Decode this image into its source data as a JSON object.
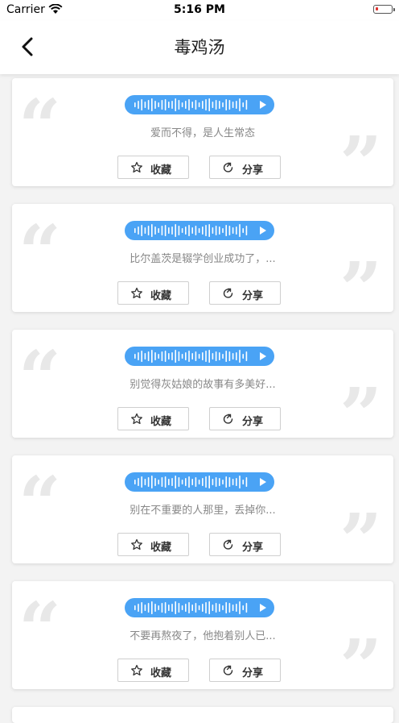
{
  "status_bar": {
    "carrier": "Carrier",
    "time": "5:16 PM"
  },
  "nav": {
    "title": "毒鸡汤"
  },
  "cards": [
    {
      "text": "爱而不得，是人生常态",
      "favorite_label": "收藏",
      "share_label": "分享"
    },
    {
      "text": "比尔盖茨是辍学创业成功了，...",
      "favorite_label": "收藏",
      "share_label": "分享"
    },
    {
      "text": "别觉得灰姑娘的故事有多美好...",
      "favorite_label": "收藏",
      "share_label": "分享"
    },
    {
      "text": "别在不重要的人那里，丢掉你...",
      "favorite_label": "收藏",
      "share_label": "分享"
    },
    {
      "text": "不要再熬夜了，他抱着别人已...",
      "favorite_label": "收藏",
      "share_label": "分享"
    }
  ],
  "icons": {
    "back": "chevron-left-icon",
    "audio": "waveform-icon",
    "play": "play-icon",
    "favorite": "star-icon",
    "share": "share-icon"
  },
  "colors": {
    "accent": "#4aa3f5",
    "background": "#f3f3f3",
    "battery_low": "#e0322f"
  }
}
